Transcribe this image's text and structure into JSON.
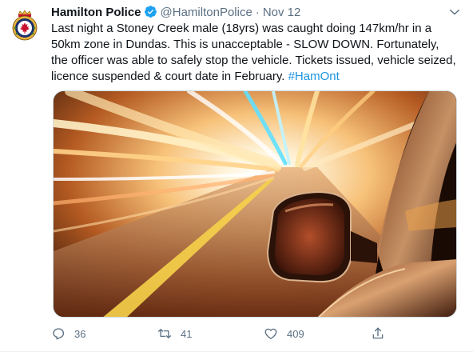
{
  "tweet": {
    "display_name": "Hamilton Police",
    "handle": "@HamiltonPolice",
    "separator": "·",
    "timestamp": "Nov 12",
    "text_main": "Last night a Stoney Creek male (18yrs) was caught doing 147km/hr in a 50km zone in Dundas. This is unacceptable - SLOW DOWN. Fortunately, the officer was able to safely stop the vehicle. Tickets issued, vehicle seized, licence suspended & court date in February.",
    "hashtag": "#HamOnt",
    "media_image": "speeding-car-light-trails-photo"
  },
  "actions": {
    "reply_count": "36",
    "retweet_count": "41",
    "like_count": "409"
  },
  "icons": {
    "avatar": "police-crest-icon",
    "verified": "verified-badge-icon",
    "more": "chevron-down-icon",
    "reply": "reply-icon",
    "retweet": "retweet-icon",
    "like": "heart-icon",
    "share": "share-icon"
  },
  "colors": {
    "text": "#0f1419",
    "secondary": "#5b7083",
    "link": "#1b95e0",
    "verified": "#1da1f2",
    "avatar_red": "#c8102e",
    "avatar_gold": "#e6b43c"
  }
}
